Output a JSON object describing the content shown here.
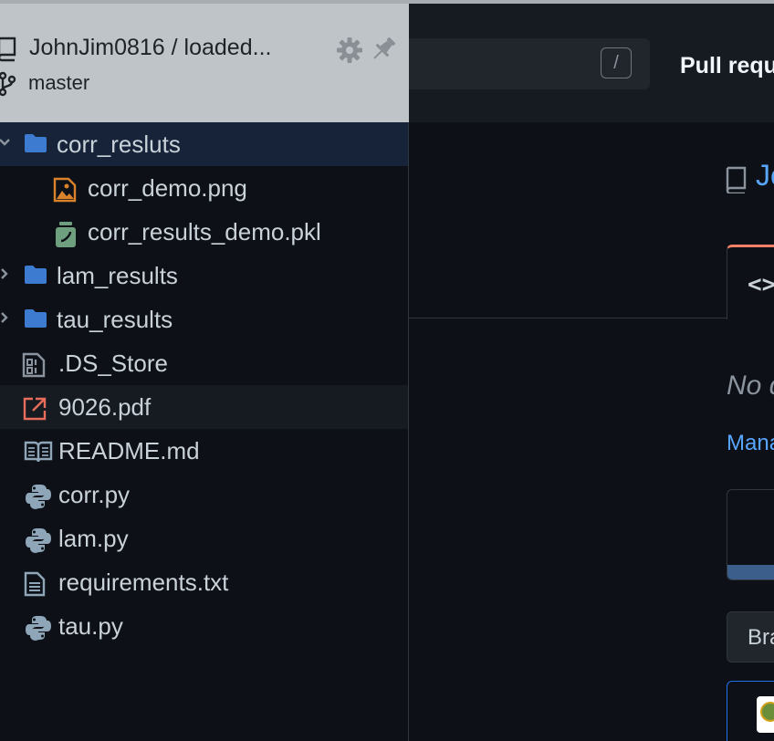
{
  "header": {
    "repo": "JohnJim0816 / loaded...",
    "branch": "master"
  },
  "tree": [
    {
      "label": "corr_resluts",
      "type": "folder",
      "expanded": true
    },
    {
      "label": "corr_demo.png",
      "type": "image"
    },
    {
      "label": "corr_results_demo.pkl",
      "type": "pickle"
    },
    {
      "label": "lam_results",
      "type": "folder",
      "expanded": false
    },
    {
      "label": "tau_results",
      "type": "folder",
      "expanded": false
    },
    {
      "label": ".DS_Store",
      "type": "binary"
    },
    {
      "label": "9026.pdf",
      "type": "pdf"
    },
    {
      "label": "README.md",
      "type": "book"
    },
    {
      "label": "corr.py",
      "type": "python"
    },
    {
      "label": "lam.py",
      "type": "python"
    },
    {
      "label": "requirements.txt",
      "type": "text"
    },
    {
      "label": "tau.py",
      "type": "python"
    }
  ],
  "page": {
    "search_key": "/",
    "pull_requests": "Pull requ",
    "repo_title": "Jo",
    "no_description": "No d",
    "manage_link": "Mana",
    "branch_button": "Bra",
    "commit_progress": 0.999
  },
  "colors": {
    "folder": "#3d7bd1",
    "selected_row": "#162338",
    "link": "#58a6ff",
    "tab_accent": "#f78166"
  }
}
